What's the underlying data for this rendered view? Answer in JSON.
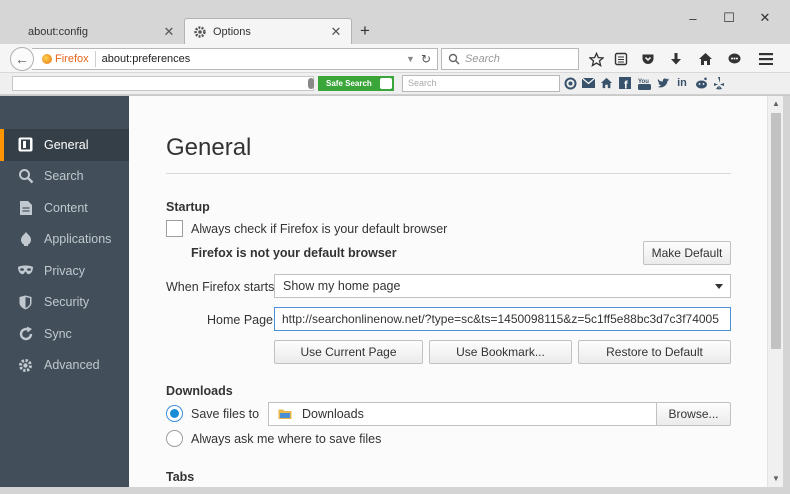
{
  "tabs": [
    {
      "label": "about:config"
    },
    {
      "label": "Options"
    }
  ],
  "navbar": {
    "identity_label": "Firefox",
    "url": "about:preferences",
    "search_placeholder": "Search"
  },
  "addon_toolbar": {
    "safe_search_label": "Safe Search",
    "safe_search_toggle": "on",
    "search_placeholder": "Search",
    "social_icons": [
      "camera-icon",
      "mail-icon",
      "home-icon",
      "facebook-icon",
      "youtube-icon",
      "twitter-icon",
      "linkedin-icon",
      "reddit-icon",
      "yelp-icon"
    ]
  },
  "sidebar": {
    "items": [
      {
        "label": "General",
        "icon": "general-icon",
        "selected": true
      },
      {
        "label": "Search",
        "icon": "search-icon",
        "selected": false
      },
      {
        "label": "Content",
        "icon": "content-icon",
        "selected": false
      },
      {
        "label": "Applications",
        "icon": "applications-icon",
        "selected": false
      },
      {
        "label": "Privacy",
        "icon": "privacy-mask-icon",
        "selected": false
      },
      {
        "label": "Security",
        "icon": "security-icon",
        "selected": false
      },
      {
        "label": "Sync",
        "icon": "sync-icon",
        "selected": false
      },
      {
        "label": "Advanced",
        "icon": "advanced-icon",
        "selected": false
      }
    ]
  },
  "main": {
    "title": "General",
    "startup": {
      "heading": "Startup",
      "default_check_label": "Always check if Firefox is your default browser",
      "default_check_checked": false,
      "not_default_text": "Firefox is not your default browser",
      "make_default_button": "Make Default",
      "when_starts_label": "When Firefox starts:",
      "when_starts_value": "Show my home page",
      "home_page_label": "Home Page:",
      "home_page_value": "http://searchonlinenow.net/?type=sc&ts=1450098115&z=5c1ff5e88bc3d7c3f74005",
      "use_current_button": "Use Current Page",
      "use_bookmark_button": "Use Bookmark...",
      "restore_default_button": "Restore to Default"
    },
    "downloads": {
      "heading": "Downloads",
      "save_files_label": "Save files to",
      "save_files_selected": true,
      "folder_value": "Downloads",
      "browse_button": "Browse...",
      "always_ask_label": "Always ask me where to save files"
    },
    "tabs_section": {
      "heading": "Tabs"
    }
  }
}
